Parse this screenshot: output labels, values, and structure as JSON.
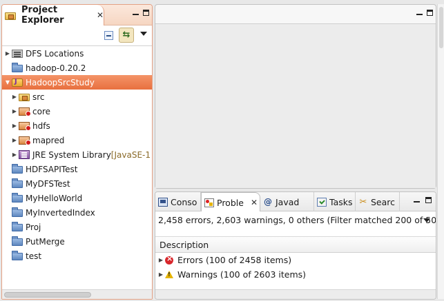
{
  "project_explorer": {
    "tab_title": "Project Explorer",
    "close_glyph": "✕",
    "link_glyph": "⇆",
    "tree": [
      {
        "label": "DFS Locations",
        "icon": "dfs-locations-icon",
        "level": 0,
        "twisty": "▶"
      },
      {
        "label": "hadoop-0.20.2",
        "icon": "folder-icon",
        "level": 0,
        "twisty": ""
      },
      {
        "label": "HadoopSrcStudy",
        "icon": "java-project-icon",
        "level": 0,
        "twisty": "▼",
        "selected": true
      },
      {
        "label": "src",
        "icon": "source-folder-icon",
        "level": 1,
        "twisty": "▶"
      },
      {
        "label": "core",
        "icon": "package-error-icon",
        "level": 1,
        "twisty": "▶"
      },
      {
        "label": "hdfs",
        "icon": "package-error-icon",
        "level": 1,
        "twisty": "▶"
      },
      {
        "label": "mapred",
        "icon": "package-error-icon",
        "level": 1,
        "twisty": "▶"
      },
      {
        "label": "JRE System Library",
        "suffix": "[JavaSE-1",
        "icon": "library-icon",
        "level": 1,
        "twisty": "▶"
      },
      {
        "label": "HDFSAPITest",
        "icon": "folder-icon",
        "level": 0,
        "twisty": ""
      },
      {
        "label": "MyDFSTest",
        "icon": "folder-icon",
        "level": 0,
        "twisty": ""
      },
      {
        "label": "MyHelloWorld",
        "icon": "folder-icon",
        "level": 0,
        "twisty": ""
      },
      {
        "label": "MyInvertedIndex",
        "icon": "folder-icon",
        "level": 0,
        "twisty": ""
      },
      {
        "label": "Proj",
        "icon": "folder-icon",
        "level": 0,
        "twisty": ""
      },
      {
        "label": "PutMerge",
        "icon": "folder-icon",
        "level": 0,
        "twisty": ""
      },
      {
        "label": "test",
        "icon": "folder-icon",
        "level": 0,
        "twisty": ""
      }
    ]
  },
  "bottom_panel": {
    "tabs": [
      {
        "label": "Conso",
        "icon": "console-icon",
        "active": false
      },
      {
        "label": "Proble",
        "icon": "problems-icon",
        "active": true,
        "close_glyph": "✕"
      },
      {
        "label": "Javad",
        "icon": "javadoc-icon",
        "icon_glyph": "@",
        "active": false
      },
      {
        "label": "Tasks",
        "icon": "tasks-icon",
        "active": false
      },
      {
        "label": "Searc",
        "icon": "search-icon",
        "icon_glyph": "✂",
        "active": false
      }
    ],
    "summary": "2,458 errors, 2,603 warnings, 0 others (Filter matched 200 of 50",
    "column_header": "Description",
    "rows": [
      {
        "label": "Errors (100 of 2458 items)",
        "icon": "error-icon",
        "twisty": "▶"
      },
      {
        "label": "Warnings (100 of 2603 items)",
        "icon": "warning-icon",
        "twisty": "▶"
      }
    ]
  },
  "colors": {
    "selection": "#ef7f50",
    "explorer_border": "#e3a083"
  }
}
